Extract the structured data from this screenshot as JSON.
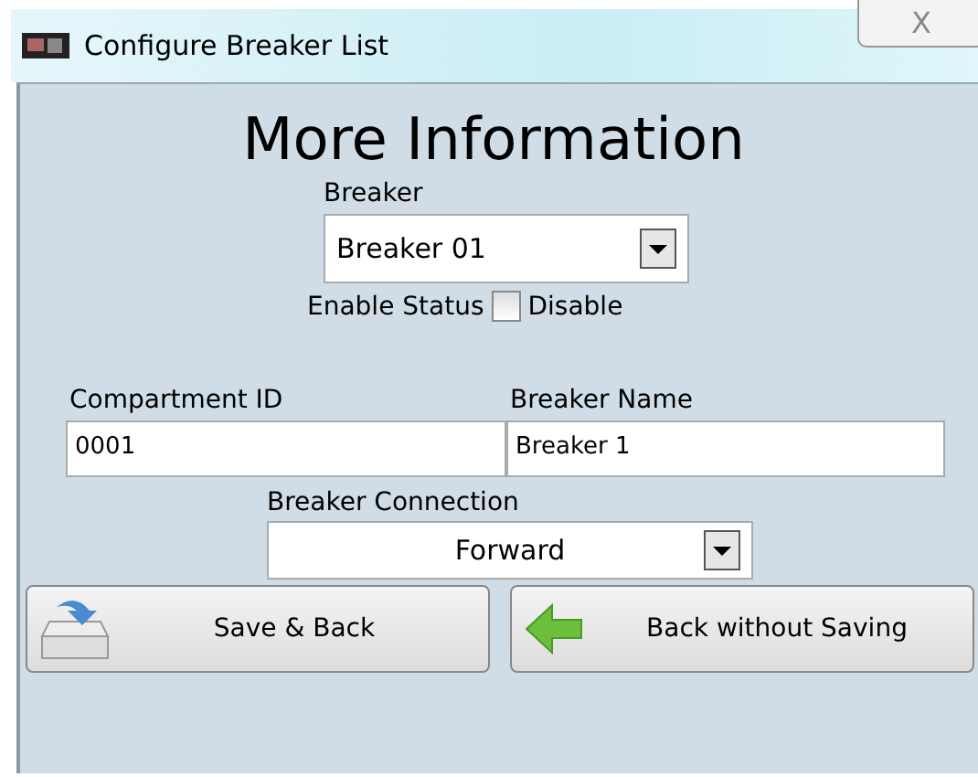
{
  "window": {
    "title": "Configure Breaker List",
    "close": "X"
  },
  "heading": "More Information",
  "breaker": {
    "label": "Breaker",
    "value": "Breaker 01"
  },
  "enable_status": {
    "label": "Enable Status",
    "checked": false,
    "option": "Disable"
  },
  "fields": [
    {
      "label": "Compartment ID",
      "value": "0001"
    },
    {
      "label": "Breaker Name",
      "value": "Breaker 1"
    }
  ],
  "connection": {
    "label": "Breaker Connection",
    "value": "Forward"
  },
  "buttons": [
    {
      "kind": "save",
      "label": "Save & Back"
    },
    {
      "kind": "back",
      "label": "Back without Saving"
    }
  ]
}
